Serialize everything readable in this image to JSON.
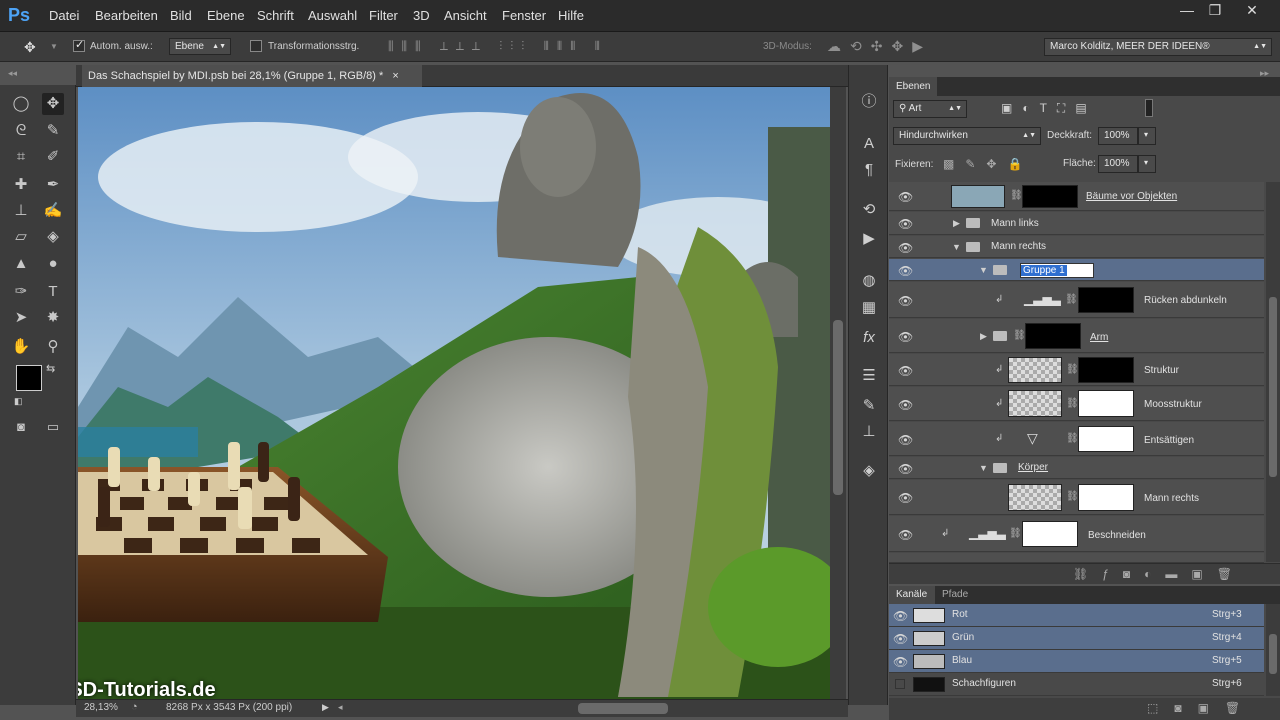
{
  "app": {
    "logo": "Ps"
  },
  "menu": [
    "Datei",
    "Bearbeiten",
    "Bild",
    "Ebene",
    "Schrift",
    "Auswahl",
    "Filter",
    "3D",
    "Ansicht",
    "Fenster",
    "Hilfe"
  ],
  "window_controls": {
    "minimize": "—",
    "restore": "❐",
    "close": "✕"
  },
  "options": {
    "auto_select_label": "Autom. ausw.:",
    "auto_select_checked": true,
    "auto_select_target": "Ebene",
    "transform_label": "Transformationsstrg.",
    "mode_3d_label": "3D-Modus:",
    "workspace": "Marco Kolditz, MEER DER IDEEN®"
  },
  "document": {
    "tab_title": "Das Schachspiel by MDI.psb bei 28,1% (Gruppe 1, RGB/8) *",
    "close_glyph": "×",
    "zoom": "28,13%",
    "doc_info": "8268 Px x 3543 Px (200 ppi)"
  },
  "watermark": "PSD-Tutorials.de",
  "layers_panel": {
    "tab": "Ebenen",
    "filter_kind": "Art",
    "blend_mode": "Hindurchwirken",
    "opacity_label": "Deckkraft:",
    "opacity": "100%",
    "lock_label": "Fixieren:",
    "fill_label": "Fläche:",
    "fill": "100%",
    "rows": [
      {
        "name": "Bäume vor Objekten",
        "type": "smart",
        "indent": 0
      },
      {
        "name": "Mann links",
        "type": "group-collapsed",
        "indent": 0
      },
      {
        "name": "Mann rechts",
        "type": "group-expanded",
        "indent": 0
      },
      {
        "name": "Gruppe 1",
        "type": "group-expanded-selected",
        "indent": 1
      },
      {
        "name": "Rücken abdunkeln",
        "type": "adjust-levels",
        "indent": 2
      },
      {
        "name": "Arm",
        "type": "group-collapsed-mask",
        "indent": 2
      },
      {
        "name": "Struktur",
        "type": "smart",
        "indent": 2
      },
      {
        "name": "Moosstruktur",
        "type": "smart",
        "indent": 2
      },
      {
        "name": "Entsättigen",
        "type": "adjust-gradient",
        "indent": 2
      },
      {
        "name": "Körper",
        "type": "group-expanded",
        "indent": 1
      },
      {
        "name": "Mann rechts",
        "type": "smart",
        "indent": 2
      },
      {
        "name": "Beschneiden",
        "type": "adjust-levels",
        "indent": 0
      }
    ]
  },
  "channels_panel": {
    "tabs": [
      "Kanäle",
      "Pfade"
    ],
    "rows": [
      {
        "name": "Rot",
        "shortcut": "Strg+3"
      },
      {
        "name": "Grün",
        "shortcut": "Strg+4"
      },
      {
        "name": "Blau",
        "shortcut": "Strg+5"
      },
      {
        "name": "Schachfiguren",
        "shortcut": "Strg+6"
      }
    ]
  },
  "colors": {
    "selection": "#5a6e8d",
    "panel": "#494949",
    "ps_blue": "#4da3f5"
  }
}
